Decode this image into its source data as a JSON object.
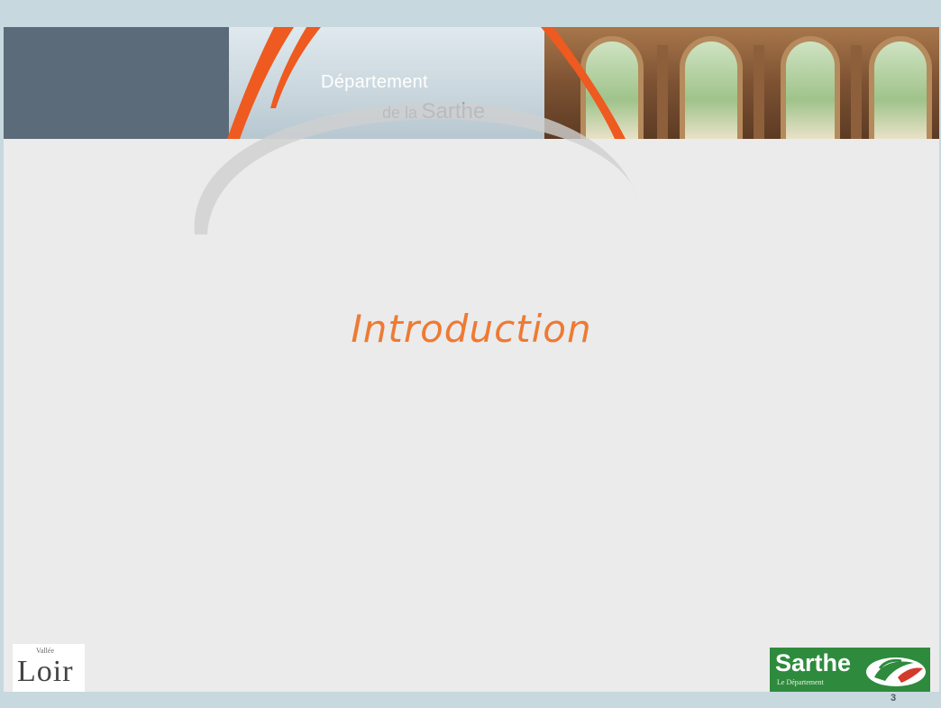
{
  "banner": {
    "title_line1": "Département",
    "title_line2_prefix": "de la",
    "title_line2_main": "Sarthe"
  },
  "slide": {
    "heading": "Introduction",
    "page_number": "3"
  },
  "logos": {
    "left_small": "Vallée",
    "left_main": "Loir",
    "right_main": "Sarthe",
    "right_sub": "Le Département"
  },
  "colors": {
    "accent_orange": "#ee7a34",
    "banner_dark": "#5b6b7a",
    "brand_green": "#2e8b3d",
    "frame_blue": "#c7d9de"
  }
}
